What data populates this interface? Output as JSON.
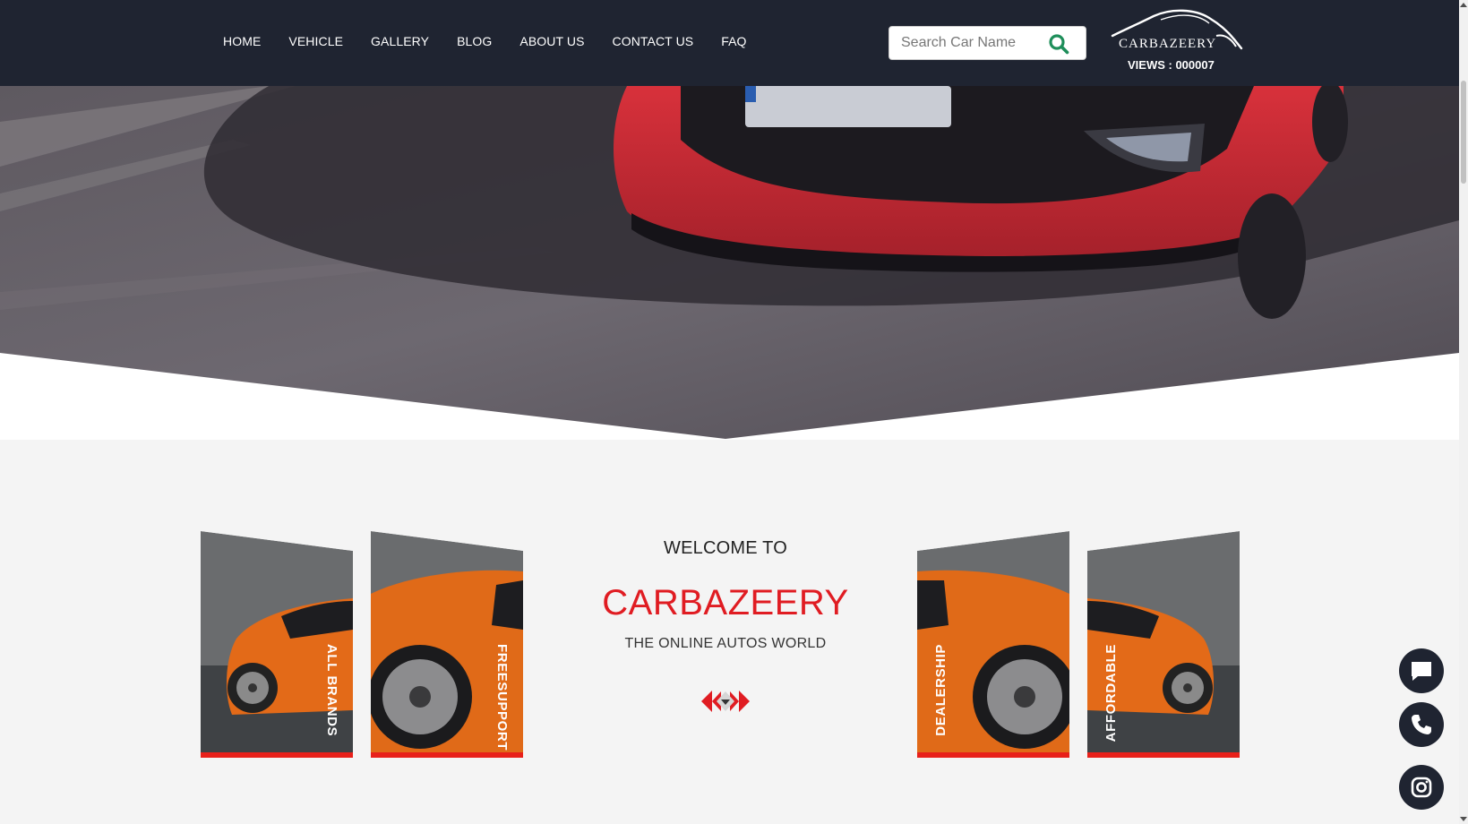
{
  "nav": {
    "items": [
      "HOME",
      "VEHICLE",
      "GALLERY",
      "BLOG",
      "ABOUT US",
      "CONTACT US",
      "FAQ"
    ]
  },
  "search": {
    "placeholder": "Search Car Name",
    "icon": "search-icon"
  },
  "brand": {
    "logo_text": "CARBAZEERY",
    "views_label": "VIEWS : 000007"
  },
  "welcome": {
    "heading": "WELCOME TO",
    "site_name": "CARBAZEERY",
    "tagline": "THE ONLINE AUTOS WORLD"
  },
  "cards": [
    {
      "label": "ALL BRANDS"
    },
    {
      "label": "FREESUPPORT"
    },
    {
      "label": "DEALERSHIP"
    },
    {
      "label": "AFFORDABLE"
    }
  ],
  "floating_buttons": [
    "chat-icon",
    "phone-icon",
    "instagram-icon"
  ],
  "colors": {
    "header_bg": "#1f2431",
    "accent_red": "#e01c22",
    "search_icon": "#1e8e5a",
    "section_bg": "#f4f4f4"
  }
}
